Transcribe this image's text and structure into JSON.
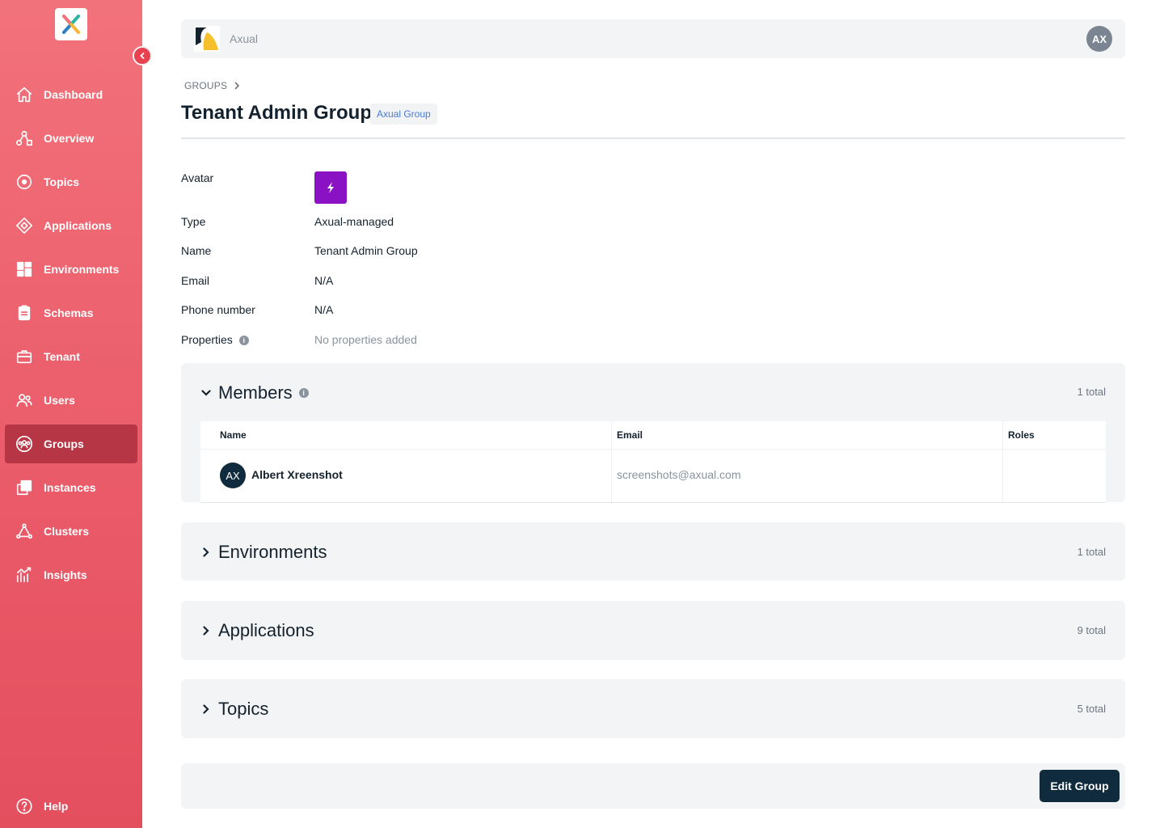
{
  "sidebar": {
    "items": [
      {
        "label": "Dashboard",
        "icon": "home-icon"
      },
      {
        "label": "Overview",
        "icon": "overview-icon"
      },
      {
        "label": "Topics",
        "icon": "topics-icon"
      },
      {
        "label": "Applications",
        "icon": "applications-icon"
      },
      {
        "label": "Environments",
        "icon": "environments-icon"
      },
      {
        "label": "Schemas",
        "icon": "schemas-icon"
      },
      {
        "label": "Tenant",
        "icon": "tenant-icon"
      },
      {
        "label": "Users",
        "icon": "users-icon"
      },
      {
        "label": "Groups",
        "icon": "groups-icon",
        "active": true
      },
      {
        "label": "Instances",
        "icon": "instances-icon"
      },
      {
        "label": "Clusters",
        "icon": "clusters-icon"
      },
      {
        "label": "Insights",
        "icon": "insights-icon"
      }
    ],
    "help_label": "Help"
  },
  "topbar": {
    "tenant_name": "Axual",
    "user_initials": "AX"
  },
  "breadcrumb": {
    "root": "GROUPS"
  },
  "page": {
    "title": "Tenant Admin Group",
    "badge": "Axual Group"
  },
  "details": {
    "avatar_label": "Avatar",
    "type_label": "Type",
    "type_value": "Axual-managed",
    "name_label": "Name",
    "name_value": "Tenant Admin Group",
    "email_label": "Email",
    "email_value": "N/A",
    "phone_label": "Phone number",
    "phone_value": "N/A",
    "properties_label": "Properties",
    "properties_value": "No properties added"
  },
  "members": {
    "title": "Members",
    "count": "1 total",
    "columns": [
      "Name",
      "Email",
      "Roles"
    ],
    "rows": [
      {
        "initials": "AX",
        "name": "Albert Xreenshot",
        "email": "screenshots@axual.com",
        "roles": ""
      }
    ]
  },
  "environments": {
    "title": "Environments",
    "count": "1 total"
  },
  "applications": {
    "title": "Applications",
    "count": "9 total"
  },
  "topics": {
    "title": "Topics",
    "count": "5 total"
  },
  "actions": {
    "edit_label": "Edit Group"
  },
  "colors": {
    "sidebar_top": "#f2727c",
    "sidebar_bottom": "#e44f5e",
    "active_nav": "#b73645",
    "primary_dark": "#0f2b3d",
    "group_avatar": "#8b12c4",
    "badge_text": "#4a7bd8"
  }
}
